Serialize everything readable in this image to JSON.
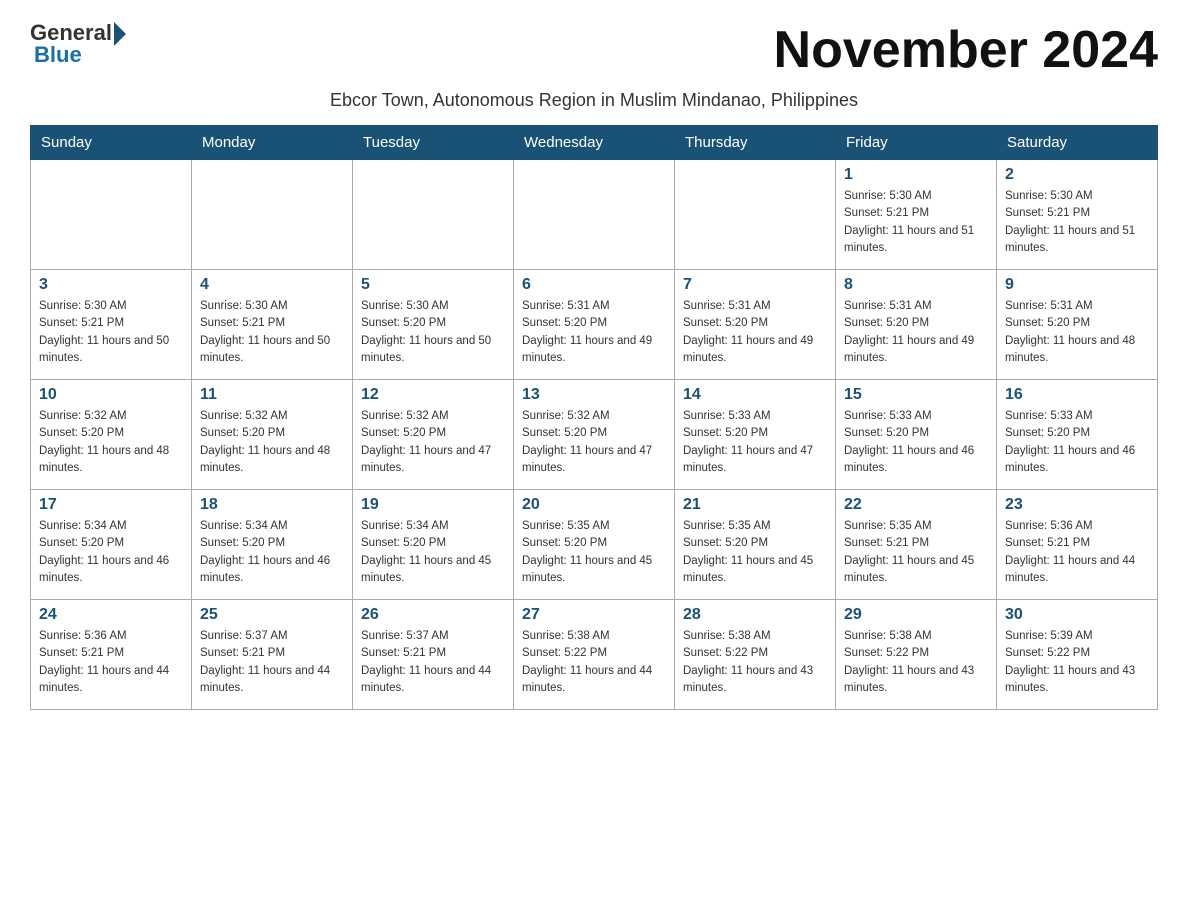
{
  "header": {
    "logo_general": "General",
    "logo_blue": "Blue",
    "month_title": "November 2024",
    "subtitle": "Ebcor Town, Autonomous Region in Muslim Mindanao, Philippines"
  },
  "days_of_week": [
    "Sunday",
    "Monday",
    "Tuesday",
    "Wednesday",
    "Thursday",
    "Friday",
    "Saturday"
  ],
  "weeks": [
    {
      "days": [
        {
          "num": "",
          "info": ""
        },
        {
          "num": "",
          "info": ""
        },
        {
          "num": "",
          "info": ""
        },
        {
          "num": "",
          "info": ""
        },
        {
          "num": "",
          "info": ""
        },
        {
          "num": "1",
          "info": "Sunrise: 5:30 AM\nSunset: 5:21 PM\nDaylight: 11 hours and 51 minutes."
        },
        {
          "num": "2",
          "info": "Sunrise: 5:30 AM\nSunset: 5:21 PM\nDaylight: 11 hours and 51 minutes."
        }
      ]
    },
    {
      "days": [
        {
          "num": "3",
          "info": "Sunrise: 5:30 AM\nSunset: 5:21 PM\nDaylight: 11 hours and 50 minutes."
        },
        {
          "num": "4",
          "info": "Sunrise: 5:30 AM\nSunset: 5:21 PM\nDaylight: 11 hours and 50 minutes."
        },
        {
          "num": "5",
          "info": "Sunrise: 5:30 AM\nSunset: 5:20 PM\nDaylight: 11 hours and 50 minutes."
        },
        {
          "num": "6",
          "info": "Sunrise: 5:31 AM\nSunset: 5:20 PM\nDaylight: 11 hours and 49 minutes."
        },
        {
          "num": "7",
          "info": "Sunrise: 5:31 AM\nSunset: 5:20 PM\nDaylight: 11 hours and 49 minutes."
        },
        {
          "num": "8",
          "info": "Sunrise: 5:31 AM\nSunset: 5:20 PM\nDaylight: 11 hours and 49 minutes."
        },
        {
          "num": "9",
          "info": "Sunrise: 5:31 AM\nSunset: 5:20 PM\nDaylight: 11 hours and 48 minutes."
        }
      ]
    },
    {
      "days": [
        {
          "num": "10",
          "info": "Sunrise: 5:32 AM\nSunset: 5:20 PM\nDaylight: 11 hours and 48 minutes."
        },
        {
          "num": "11",
          "info": "Sunrise: 5:32 AM\nSunset: 5:20 PM\nDaylight: 11 hours and 48 minutes."
        },
        {
          "num": "12",
          "info": "Sunrise: 5:32 AM\nSunset: 5:20 PM\nDaylight: 11 hours and 47 minutes."
        },
        {
          "num": "13",
          "info": "Sunrise: 5:32 AM\nSunset: 5:20 PM\nDaylight: 11 hours and 47 minutes."
        },
        {
          "num": "14",
          "info": "Sunrise: 5:33 AM\nSunset: 5:20 PM\nDaylight: 11 hours and 47 minutes."
        },
        {
          "num": "15",
          "info": "Sunrise: 5:33 AM\nSunset: 5:20 PM\nDaylight: 11 hours and 46 minutes."
        },
        {
          "num": "16",
          "info": "Sunrise: 5:33 AM\nSunset: 5:20 PM\nDaylight: 11 hours and 46 minutes."
        }
      ]
    },
    {
      "days": [
        {
          "num": "17",
          "info": "Sunrise: 5:34 AM\nSunset: 5:20 PM\nDaylight: 11 hours and 46 minutes."
        },
        {
          "num": "18",
          "info": "Sunrise: 5:34 AM\nSunset: 5:20 PM\nDaylight: 11 hours and 46 minutes."
        },
        {
          "num": "19",
          "info": "Sunrise: 5:34 AM\nSunset: 5:20 PM\nDaylight: 11 hours and 45 minutes."
        },
        {
          "num": "20",
          "info": "Sunrise: 5:35 AM\nSunset: 5:20 PM\nDaylight: 11 hours and 45 minutes."
        },
        {
          "num": "21",
          "info": "Sunrise: 5:35 AM\nSunset: 5:20 PM\nDaylight: 11 hours and 45 minutes."
        },
        {
          "num": "22",
          "info": "Sunrise: 5:35 AM\nSunset: 5:21 PM\nDaylight: 11 hours and 45 minutes."
        },
        {
          "num": "23",
          "info": "Sunrise: 5:36 AM\nSunset: 5:21 PM\nDaylight: 11 hours and 44 minutes."
        }
      ]
    },
    {
      "days": [
        {
          "num": "24",
          "info": "Sunrise: 5:36 AM\nSunset: 5:21 PM\nDaylight: 11 hours and 44 minutes."
        },
        {
          "num": "25",
          "info": "Sunrise: 5:37 AM\nSunset: 5:21 PM\nDaylight: 11 hours and 44 minutes."
        },
        {
          "num": "26",
          "info": "Sunrise: 5:37 AM\nSunset: 5:21 PM\nDaylight: 11 hours and 44 minutes."
        },
        {
          "num": "27",
          "info": "Sunrise: 5:38 AM\nSunset: 5:22 PM\nDaylight: 11 hours and 44 minutes."
        },
        {
          "num": "28",
          "info": "Sunrise: 5:38 AM\nSunset: 5:22 PM\nDaylight: 11 hours and 43 minutes."
        },
        {
          "num": "29",
          "info": "Sunrise: 5:38 AM\nSunset: 5:22 PM\nDaylight: 11 hours and 43 minutes."
        },
        {
          "num": "30",
          "info": "Sunrise: 5:39 AM\nSunset: 5:22 PM\nDaylight: 11 hours and 43 minutes."
        }
      ]
    }
  ]
}
